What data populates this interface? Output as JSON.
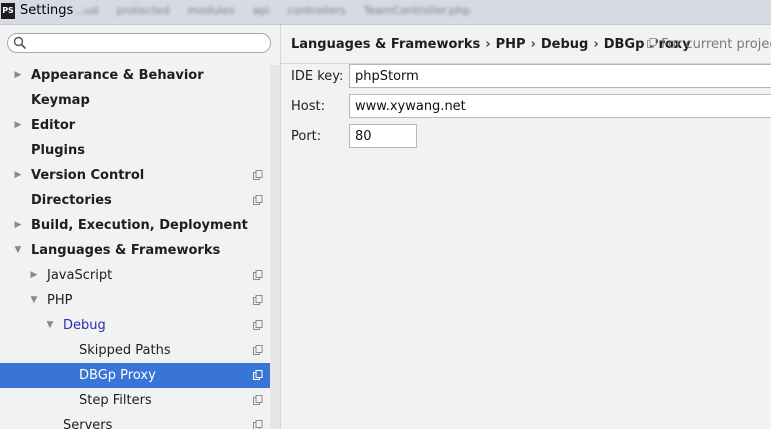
{
  "window": {
    "logo": "PS",
    "title": "Settings",
    "background_tabs": [
      "...ud",
      "protected",
      "modules",
      "api",
      "controllers",
      "TeamController.php"
    ]
  },
  "search": {
    "value": "",
    "placeholder": ""
  },
  "tree": [
    {
      "label": "Appearance & Behavior",
      "arrow": "right",
      "bold": true,
      "project": false
    },
    {
      "label": "Keymap",
      "arrow": "",
      "bold": true,
      "project": false
    },
    {
      "label": "Editor",
      "arrow": "right",
      "bold": true,
      "project": false
    },
    {
      "label": "Plugins",
      "arrow": "",
      "bold": true,
      "project": false
    },
    {
      "label": "Version Control",
      "arrow": "right",
      "bold": true,
      "project": true
    },
    {
      "label": "Directories",
      "arrow": "",
      "bold": true,
      "project": true
    },
    {
      "label": "Build, Execution, Deployment",
      "arrow": "right",
      "bold": true,
      "project": false
    },
    {
      "label": "Languages & Frameworks",
      "arrow": "down",
      "bold": true,
      "project": false
    },
    {
      "label": "JavaScript",
      "arrow": "right",
      "bold": false,
      "project": true
    },
    {
      "label": "PHP",
      "arrow": "down",
      "bold": false,
      "project": true
    },
    {
      "label": "Debug",
      "arrow": "down",
      "bold": false,
      "project": true,
      "highlight": true
    },
    {
      "label": "Skipped Paths",
      "arrow": "",
      "bold": false,
      "project": true
    },
    {
      "label": "DBGp Proxy",
      "arrow": "",
      "bold": false,
      "project": true,
      "selected": true
    },
    {
      "label": "Step Filters",
      "arrow": "",
      "bold": false,
      "project": true
    },
    {
      "label": "Servers",
      "arrow": "",
      "bold": false,
      "project": true
    }
  ],
  "breadcrumb": [
    "Languages & Frameworks",
    "PHP",
    "Debug",
    "DBGp Proxy"
  ],
  "breadcrumb_separator": "›",
  "scope_note": "For current project",
  "form": {
    "ide_key_label": "IDE key:",
    "ide_key_value": "phpStorm",
    "host_label": "Host:",
    "host_value": "www.xywang.net",
    "port_label": "Port:",
    "port_value": "80"
  },
  "colors": {
    "selection": "#3875d7",
    "highlight_text": "#2929b8"
  }
}
